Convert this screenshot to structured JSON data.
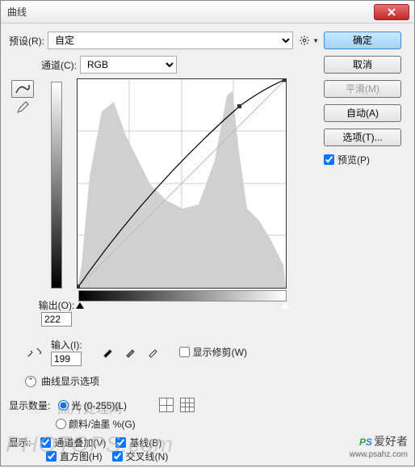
{
  "window": {
    "title": "曲线"
  },
  "preset": {
    "label": "预设(R):",
    "value": "自定"
  },
  "buttons": {
    "ok": "确定",
    "cancel": "取消",
    "smooth": "平滑(M)",
    "auto": "自动(A)",
    "options": "选项(T)..."
  },
  "preview": {
    "label": "预览(P)",
    "checked": true
  },
  "channel": {
    "label": "通道(C):",
    "value": "RGB"
  },
  "output": {
    "label": "输出(O):",
    "value": "222"
  },
  "input": {
    "label": "输入(I):",
    "value": "199"
  },
  "show_clipping": {
    "label": "显示修剪(W)",
    "checked": false
  },
  "curve_options_toggle": "曲线显示选项",
  "amount": {
    "label": "显示数量:",
    "light": "光 (0-255)(L)",
    "pigment": "颜料/油墨 %(G)"
  },
  "show": {
    "label": "显示:",
    "overlay": "通道叠加(V)",
    "baseline": "基线(B)",
    "histogram": "直方图(H)",
    "intersection": "交叉线(N)"
  },
  "watermarks": {
    "main": "PHOTOPS.com",
    "cn": "照片处理网",
    "logo_cn": "爱好者",
    "logo_url": "www.psahz.com"
  },
  "chart_data": {
    "type": "curve",
    "title": "曲线",
    "xlabel": "输入",
    "ylabel": "输出",
    "xlim": [
      0,
      255
    ],
    "ylim": [
      0,
      255
    ],
    "control_points": [
      {
        "in": 0,
        "out": 0
      },
      {
        "in": 199,
        "out": 222
      },
      {
        "in": 255,
        "out": 255
      }
    ],
    "baseline": "identity",
    "histogram_peaks_approx": [
      {
        "x": 40,
        "h": 0.85
      },
      {
        "x": 80,
        "h": 0.55
      },
      {
        "x": 190,
        "h": 0.95
      },
      {
        "x": 220,
        "h": 0.35
      }
    ]
  }
}
